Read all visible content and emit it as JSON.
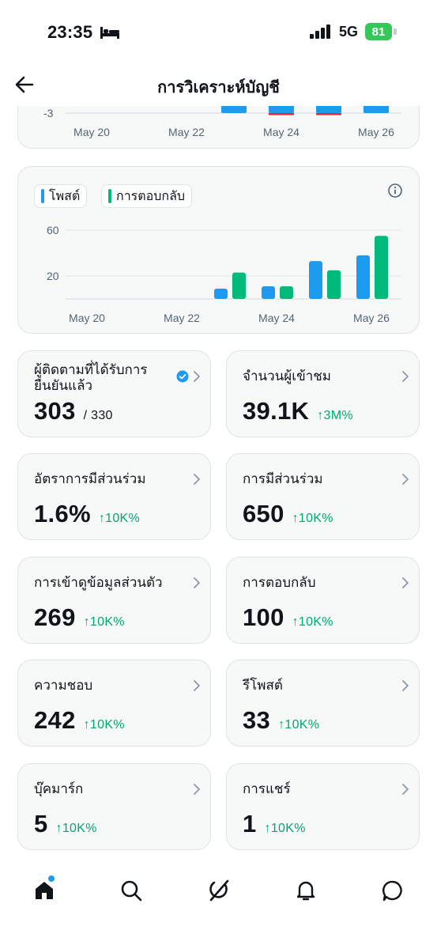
{
  "status_bar": {
    "time": "23:35",
    "network": "5G",
    "battery": "81"
  },
  "header": {
    "title": "การวิเคราะห์บัญชี"
  },
  "colors": {
    "posts": "#1d9bf0",
    "replies": "#00ba7c",
    "negative": "#f4212e",
    "delta": "#00a86b"
  },
  "chart_data": [
    {
      "type": "bar",
      "x": [
        "May 20",
        "May 21",
        "May 22",
        "May 23",
        "May 24",
        "May 25",
        "May 26"
      ],
      "yticks": [
        -3
      ],
      "series": [
        {
          "values": [
            0,
            0,
            0,
            1,
            1,
            1,
            1
          ]
        },
        {
          "values": [
            0,
            0,
            0,
            0,
            -0.3,
            -0.3,
            0
          ]
        }
      ],
      "xtick_labels": [
        "May 20",
        "May 22",
        "May 24",
        "May 26"
      ]
    },
    {
      "type": "bar",
      "x": [
        "May 20",
        "May 21",
        "May 22",
        "May 23",
        "May 24",
        "May 25",
        "May 26"
      ],
      "yticks": [
        "60",
        "20"
      ],
      "ylim": [
        0,
        70
      ],
      "legend": [
        "โพสต์",
        "การตอบกลับ"
      ],
      "series": [
        {
          "name": "โพสต์",
          "values": [
            0,
            0,
            0,
            9,
            11,
            33,
            38
          ]
        },
        {
          "name": "การตอบกลับ",
          "values": [
            0,
            0,
            0,
            23,
            11,
            25,
            55
          ]
        }
      ],
      "xtick_labels": [
        "May 20",
        "May 22",
        "May 24",
        "May 26"
      ]
    }
  ],
  "metrics": [
    {
      "label": "ผู้ติดตามที่ได้รับการยืนยันแล้ว",
      "value": "303",
      "sub": "/ 330",
      "delta": ""
    },
    {
      "label": "จำนวนผู้เข้าชม",
      "value": "39.1K",
      "sub": "",
      "delta": "↑3M%"
    },
    {
      "label": "อัตราการมีส่วนร่วม",
      "value": "1.6%",
      "sub": "",
      "delta": "↑10K%"
    },
    {
      "label": "การมีส่วนร่วม",
      "value": "650",
      "sub": "",
      "delta": "↑10K%"
    },
    {
      "label": "การเข้าดูข้อมูลส่วนตัว",
      "value": "269",
      "sub": "",
      "delta": "↑10K%"
    },
    {
      "label": "การตอบกลับ",
      "value": "100",
      "sub": "",
      "delta": "↑10K%"
    },
    {
      "label": "ความชอบ",
      "value": "242",
      "sub": "",
      "delta": "↑10K%"
    },
    {
      "label": "รีโพสต์",
      "value": "33",
      "sub": "",
      "delta": "↑10K%"
    },
    {
      "label": "บุ๊คมาร์ก",
      "value": "5",
      "sub": "",
      "delta": "↑10K%"
    },
    {
      "label": "การแชร์",
      "value": "1",
      "sub": "",
      "delta": "↑10K%"
    }
  ],
  "bottom_nav": [
    "home-icon",
    "search-icon",
    "grok-icon",
    "bell-icon",
    "chat-icon"
  ]
}
